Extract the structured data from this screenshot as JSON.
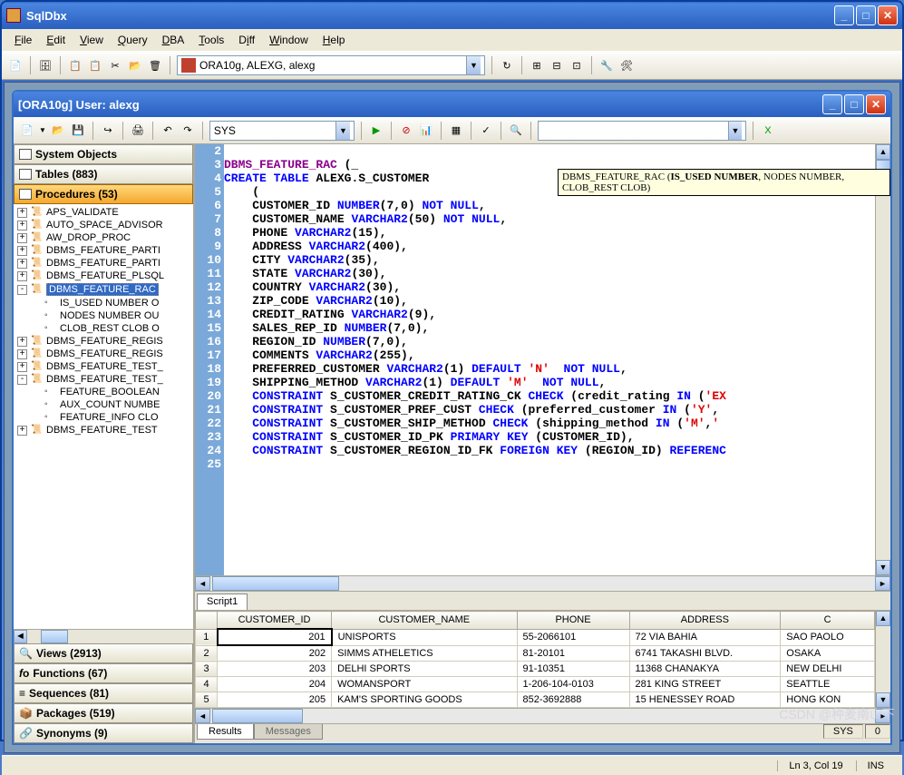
{
  "app": {
    "title": "SqlDbx"
  },
  "menu": [
    "File",
    "Edit",
    "View",
    "Query",
    "DBA",
    "Tools",
    "Diff",
    "Window",
    "Help"
  ],
  "main_combo": "ORA10g, ALEXG, alexg",
  "doc": {
    "title": "[ORA10g] User: alexg",
    "schema_combo": "SYS",
    "search_value": ""
  },
  "categories": [
    {
      "label": "System Objects",
      "icon": "🗂"
    },
    {
      "label": "Tables (883)",
      "icon": "▦"
    },
    {
      "label": "Procedures (53)",
      "icon": "📜",
      "selected": true
    },
    {
      "label": "Views (2913)",
      "icon": "🔍"
    },
    {
      "label": "Functions (67)",
      "icon": "ƒ"
    },
    {
      "label": "Sequences (81)",
      "icon": "≡"
    },
    {
      "label": "Packages (519)",
      "icon": "📦"
    },
    {
      "label": "Synonyms (9)",
      "icon": "🔗"
    }
  ],
  "tree": [
    {
      "t": "p",
      "pm": "+",
      "label": "APS_VALIDATE"
    },
    {
      "t": "p",
      "pm": "+",
      "label": "AUTO_SPACE_ADVISOR"
    },
    {
      "t": "p",
      "pm": "+",
      "label": "AW_DROP_PROC"
    },
    {
      "t": "p",
      "pm": "+",
      "label": "DBMS_FEATURE_PARTI"
    },
    {
      "t": "p",
      "pm": "+",
      "label": "DBMS_FEATURE_PARTI"
    },
    {
      "t": "p",
      "pm": "+",
      "label": "DBMS_FEATURE_PLSQL"
    },
    {
      "t": "p",
      "pm": "-",
      "label": "DBMS_FEATURE_RAC",
      "sel": true
    },
    {
      "t": "c",
      "label": "IS_USED NUMBER O"
    },
    {
      "t": "c",
      "label": "NODES NUMBER OU"
    },
    {
      "t": "c",
      "label": "CLOB_REST CLOB O"
    },
    {
      "t": "p",
      "pm": "+",
      "label": "DBMS_FEATURE_REGIS"
    },
    {
      "t": "p",
      "pm": "+",
      "label": "DBMS_FEATURE_REGIS"
    },
    {
      "t": "p",
      "pm": "+",
      "label": "DBMS_FEATURE_TEST_"
    },
    {
      "t": "p",
      "pm": "-",
      "label": "DBMS_FEATURE_TEST_"
    },
    {
      "t": "c",
      "label": "FEATURE_BOOLEAN"
    },
    {
      "t": "c",
      "label": "AUX_COUNT NUMBE"
    },
    {
      "t": "c",
      "label": "FEATURE_INFO CLO"
    },
    {
      "t": "p",
      "pm": "+",
      "label": "DBMS_FEATURE_TEST"
    }
  ],
  "code": {
    "lines": [
      2,
      3,
      4,
      5,
      6,
      7,
      8,
      9,
      10,
      11,
      12,
      13,
      14,
      15,
      16,
      17,
      18,
      19,
      20,
      21,
      22,
      23,
      24,
      25
    ],
    "tooltip_prefix": "DBMS_FEATURE_RAC (",
    "tooltip_bold": "IS_USED NUMBER",
    "tooltip_suffix": ", NODES NUMBER, CLOB_REST CLOB)"
  },
  "script_tab": "Script1",
  "grid": {
    "headers": [
      "",
      "CUSTOMER_ID",
      "CUSTOMER_NAME",
      "PHONE",
      "ADDRESS",
      "C"
    ],
    "rows": [
      {
        "n": 1,
        "id": 201,
        "name": "UNISPORTS",
        "phone": "55-2066101",
        "addr": "72 VIA BAHIA",
        "c": "SAO PAOLO"
      },
      {
        "n": 2,
        "id": 202,
        "name": "SIMMS ATHELETICS",
        "phone": "81-20101",
        "addr": "6741 TAKASHI BLVD.",
        "c": "OSAKA"
      },
      {
        "n": 3,
        "id": 203,
        "name": "DELHI SPORTS",
        "phone": "91-10351",
        "addr": "11368 CHANAKYA",
        "c": "NEW DELHI"
      },
      {
        "n": 4,
        "id": 204,
        "name": "WOMANSPORT",
        "phone": "1-206-104-0103",
        "addr": "281 KING STREET",
        "c": "SEATTLE"
      },
      {
        "n": 5,
        "id": 205,
        "name": "KAM'S SPORTING GOODS",
        "phone": "852-3692888",
        "addr": "15 HENESSEY ROAD",
        "c": "HONG KON"
      }
    ]
  },
  "bottom_tabs": [
    "Results",
    "Messages"
  ],
  "bottom_status": {
    "schema": "SYS",
    "rows": "0"
  },
  "status": {
    "pos": "Ln 3, Col 19",
    "mode": "INS"
  },
  "watermark": "CSDN @种麦南山下"
}
